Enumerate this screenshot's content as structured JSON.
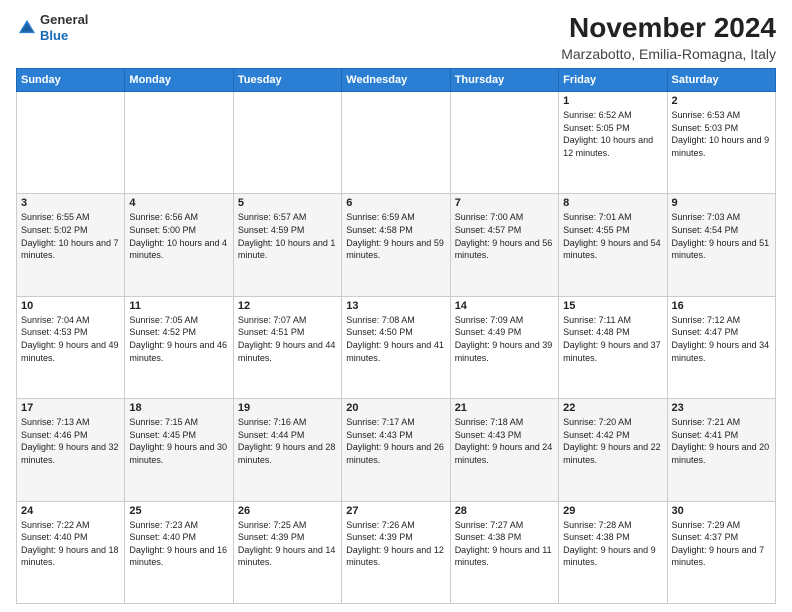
{
  "header": {
    "logo_general": "General",
    "logo_blue": "Blue",
    "month_title": "November 2024",
    "location": "Marzabotto, Emilia-Romagna, Italy"
  },
  "weekdays": [
    "Sunday",
    "Monday",
    "Tuesday",
    "Wednesday",
    "Thursday",
    "Friday",
    "Saturday"
  ],
  "weeks": [
    [
      {
        "day": "",
        "info": ""
      },
      {
        "day": "",
        "info": ""
      },
      {
        "day": "",
        "info": ""
      },
      {
        "day": "",
        "info": ""
      },
      {
        "day": "",
        "info": ""
      },
      {
        "day": "1",
        "info": "Sunrise: 6:52 AM\nSunset: 5:05 PM\nDaylight: 10 hours\nand 12 minutes."
      },
      {
        "day": "2",
        "info": "Sunrise: 6:53 AM\nSunset: 5:03 PM\nDaylight: 10 hours\nand 9 minutes."
      }
    ],
    [
      {
        "day": "3",
        "info": "Sunrise: 6:55 AM\nSunset: 5:02 PM\nDaylight: 10 hours\nand 7 minutes."
      },
      {
        "day": "4",
        "info": "Sunrise: 6:56 AM\nSunset: 5:00 PM\nDaylight: 10 hours\nand 4 minutes."
      },
      {
        "day": "5",
        "info": "Sunrise: 6:57 AM\nSunset: 4:59 PM\nDaylight: 10 hours\nand 1 minute."
      },
      {
        "day": "6",
        "info": "Sunrise: 6:59 AM\nSunset: 4:58 PM\nDaylight: 9 hours\nand 59 minutes."
      },
      {
        "day": "7",
        "info": "Sunrise: 7:00 AM\nSunset: 4:57 PM\nDaylight: 9 hours\nand 56 minutes."
      },
      {
        "day": "8",
        "info": "Sunrise: 7:01 AM\nSunset: 4:55 PM\nDaylight: 9 hours\nand 54 minutes."
      },
      {
        "day": "9",
        "info": "Sunrise: 7:03 AM\nSunset: 4:54 PM\nDaylight: 9 hours\nand 51 minutes."
      }
    ],
    [
      {
        "day": "10",
        "info": "Sunrise: 7:04 AM\nSunset: 4:53 PM\nDaylight: 9 hours\nand 49 minutes."
      },
      {
        "day": "11",
        "info": "Sunrise: 7:05 AM\nSunset: 4:52 PM\nDaylight: 9 hours\nand 46 minutes."
      },
      {
        "day": "12",
        "info": "Sunrise: 7:07 AM\nSunset: 4:51 PM\nDaylight: 9 hours\nand 44 minutes."
      },
      {
        "day": "13",
        "info": "Sunrise: 7:08 AM\nSunset: 4:50 PM\nDaylight: 9 hours\nand 41 minutes."
      },
      {
        "day": "14",
        "info": "Sunrise: 7:09 AM\nSunset: 4:49 PM\nDaylight: 9 hours\nand 39 minutes."
      },
      {
        "day": "15",
        "info": "Sunrise: 7:11 AM\nSunset: 4:48 PM\nDaylight: 9 hours\nand 37 minutes."
      },
      {
        "day": "16",
        "info": "Sunrise: 7:12 AM\nSunset: 4:47 PM\nDaylight: 9 hours\nand 34 minutes."
      }
    ],
    [
      {
        "day": "17",
        "info": "Sunrise: 7:13 AM\nSunset: 4:46 PM\nDaylight: 9 hours\nand 32 minutes."
      },
      {
        "day": "18",
        "info": "Sunrise: 7:15 AM\nSunset: 4:45 PM\nDaylight: 9 hours\nand 30 minutes."
      },
      {
        "day": "19",
        "info": "Sunrise: 7:16 AM\nSunset: 4:44 PM\nDaylight: 9 hours\nand 28 minutes."
      },
      {
        "day": "20",
        "info": "Sunrise: 7:17 AM\nSunset: 4:43 PM\nDaylight: 9 hours\nand 26 minutes."
      },
      {
        "day": "21",
        "info": "Sunrise: 7:18 AM\nSunset: 4:43 PM\nDaylight: 9 hours\nand 24 minutes."
      },
      {
        "day": "22",
        "info": "Sunrise: 7:20 AM\nSunset: 4:42 PM\nDaylight: 9 hours\nand 22 minutes."
      },
      {
        "day": "23",
        "info": "Sunrise: 7:21 AM\nSunset: 4:41 PM\nDaylight: 9 hours\nand 20 minutes."
      }
    ],
    [
      {
        "day": "24",
        "info": "Sunrise: 7:22 AM\nSunset: 4:40 PM\nDaylight: 9 hours\nand 18 minutes."
      },
      {
        "day": "25",
        "info": "Sunrise: 7:23 AM\nSunset: 4:40 PM\nDaylight: 9 hours\nand 16 minutes."
      },
      {
        "day": "26",
        "info": "Sunrise: 7:25 AM\nSunset: 4:39 PM\nDaylight: 9 hours\nand 14 minutes."
      },
      {
        "day": "27",
        "info": "Sunrise: 7:26 AM\nSunset: 4:39 PM\nDaylight: 9 hours\nand 12 minutes."
      },
      {
        "day": "28",
        "info": "Sunrise: 7:27 AM\nSunset: 4:38 PM\nDaylight: 9 hours\nand 11 minutes."
      },
      {
        "day": "29",
        "info": "Sunrise: 7:28 AM\nSunset: 4:38 PM\nDaylight: 9 hours\nand 9 minutes."
      },
      {
        "day": "30",
        "info": "Sunrise: 7:29 AM\nSunset: 4:37 PM\nDaylight: 9 hours\nand 7 minutes."
      }
    ]
  ]
}
